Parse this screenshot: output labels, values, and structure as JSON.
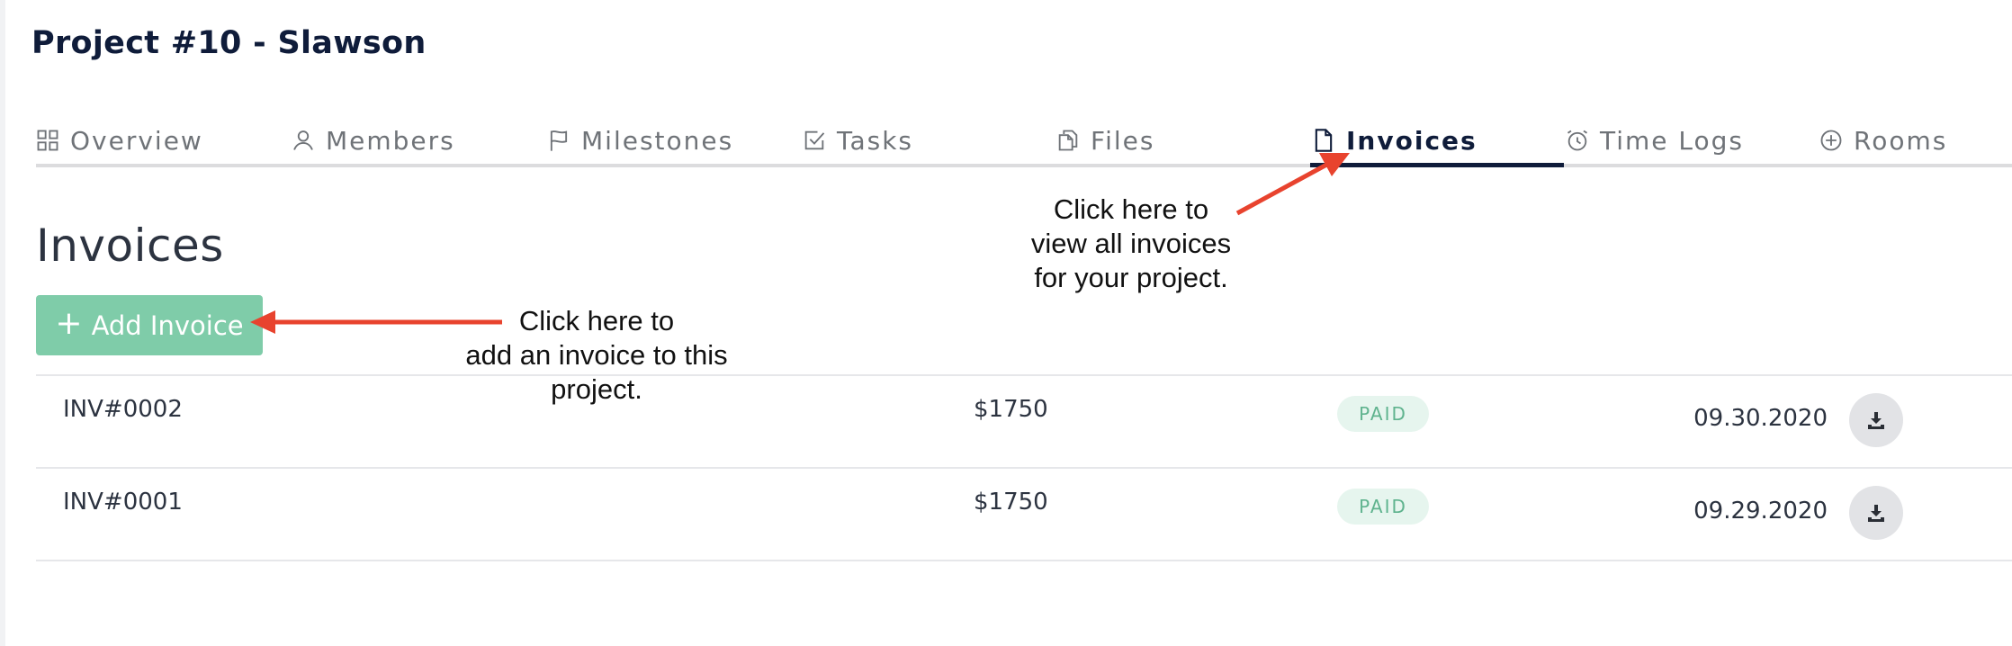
{
  "project": {
    "title": "Project #10 - Slawson"
  },
  "tabs": [
    {
      "label": "Overview",
      "icon": "grid-icon"
    },
    {
      "label": "Members",
      "icon": "user-icon"
    },
    {
      "label": "Milestones",
      "icon": "flag-icon"
    },
    {
      "label": "Tasks",
      "icon": "checkbox-icon"
    },
    {
      "label": "Files",
      "icon": "files-icon"
    },
    {
      "label": "Invoices",
      "icon": "document-icon",
      "active": true
    },
    {
      "label": "Time Logs",
      "icon": "alarm-clock-icon"
    },
    {
      "label": "Rooms",
      "icon": "plus-circle-icon"
    }
  ],
  "section": {
    "title": "Invoices",
    "add_button_label": "Add Invoice"
  },
  "invoices": [
    {
      "number": "INV#0002",
      "amount": "$1750",
      "status": "PAID",
      "date": "09.30.2020"
    },
    {
      "number": "INV#0001",
      "amount": "$1750",
      "status": "PAID",
      "date": "09.29.2020"
    }
  ],
  "annotations": {
    "tab_hint": "Click here to\nview all invoices\nfor your project.",
    "add_hint": "Click here to\nadd an invoice to this\nproject."
  },
  "colors": {
    "accent": "#7fcca9",
    "active_tab": "#0f1c3a",
    "status_paid_bg": "#e6f5ee",
    "status_paid_text": "#5fb38e",
    "annotation_arrow": "#e8432e"
  }
}
